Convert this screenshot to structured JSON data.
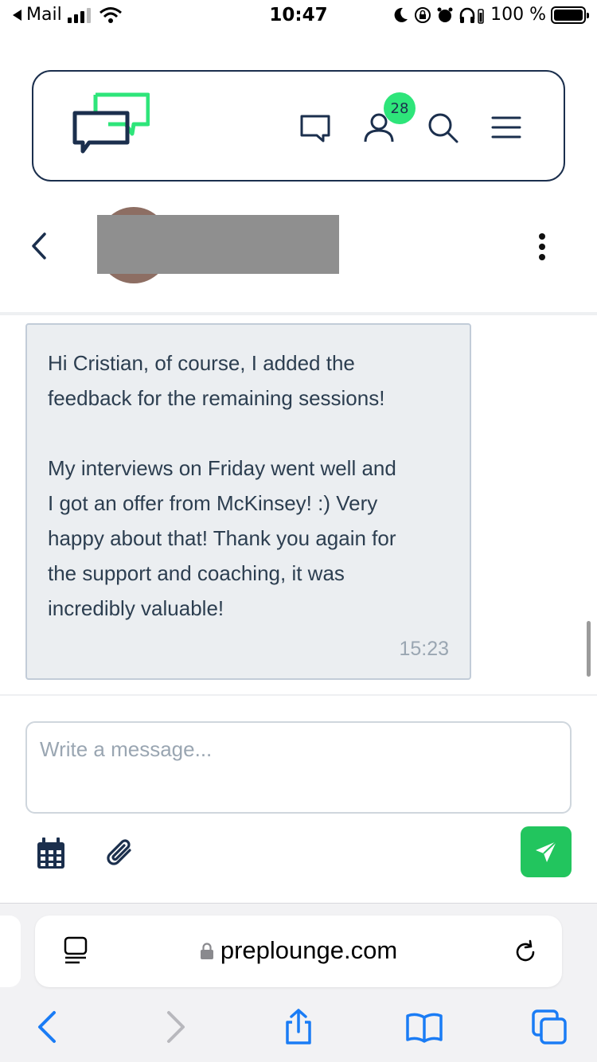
{
  "status_bar": {
    "back_app": "Mail",
    "time": "10:47",
    "battery": "100 %"
  },
  "site_header": {
    "notification_count": "28"
  },
  "message": {
    "text": "Hi Cristian, of course, I added the\nfeedback for the remaining sessions!\n\nMy interviews on Friday went well and\nI got an offer from McKinsey! :) Very\nhappy about that! Thank you again for\nthe support and coaching, it was\nincredibly valuable!",
    "time": "15:23"
  },
  "composer": {
    "placeholder": "Write a message..."
  },
  "browser": {
    "url": "preplounge.com"
  },
  "colors": {
    "brand_navy": "#1b2f4d",
    "brand_green": "#2ee57a",
    "send_green": "#22c55e",
    "browser_blue": "#1a7cf5"
  }
}
